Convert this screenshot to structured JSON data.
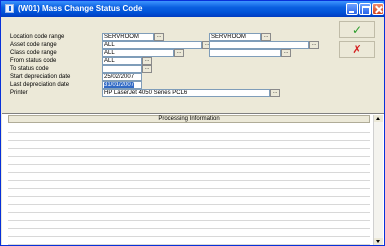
{
  "window": {
    "title": "(W01) Mass Change Status Code"
  },
  "form": {
    "labels": {
      "location_code_range": "Location code range",
      "asset_code_range": "Asset code range",
      "class_code_range": "Class code range",
      "from_status_code": "From status code",
      "to_status_code": "To status code",
      "start_depreciation_date": "Start depreciation date",
      "last_depreciation_date": "Last depreciation date",
      "printer": "Printer"
    },
    "values": {
      "location_from": "SERVROOM",
      "location_to": "SERVROOM",
      "asset_from": "ALL",
      "asset_to": "",
      "class_from": "ALL",
      "class_to": "",
      "from_status": "ALL",
      "to_status": "",
      "start_depreciation": "25/02/2007",
      "last_depreciation": "31/01/2007",
      "printer": "HP LaserJet 4050 Series PCL6"
    },
    "lookup_label": "..."
  },
  "actions": {
    "ok_glyph": "✓",
    "cancel_glyph": "✗"
  },
  "grid": {
    "header": "Processing Information",
    "row_count": 15
  },
  "icons": {
    "app": "app-icon",
    "minimize": "minimize-icon",
    "maximize": "maximize-icon",
    "close": "close-icon",
    "ok": "checkmark-icon",
    "cancel": "cross-icon"
  },
  "colors": {
    "title_bar": "#0053d8",
    "ok": "#2a9c2a",
    "cancel": "#d42020",
    "selection": "#316ac5"
  }
}
